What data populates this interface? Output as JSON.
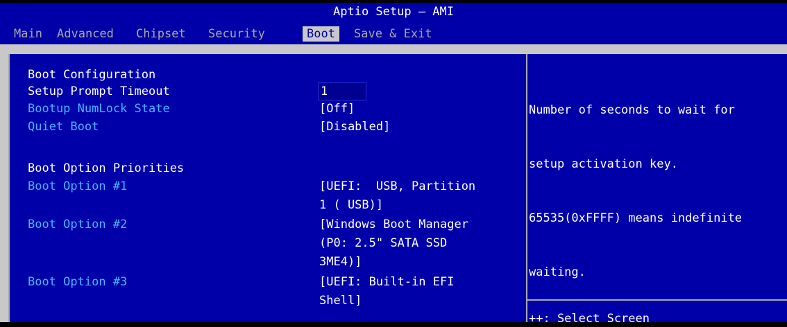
{
  "window": {
    "title": "Aptio Setup – AMI"
  },
  "tabs": [
    {
      "label": "Main"
    },
    {
      "label": "Advanced"
    },
    {
      "label": "Chipset"
    },
    {
      "label": "Security"
    },
    {
      "label": "Boot"
    },
    {
      "label": "Save & Exit"
    }
  ],
  "main": {
    "boot_config_heading": "Boot Configuration",
    "setup_prompt_timeout": {
      "label": "Setup Prompt Timeout",
      "value": "1"
    },
    "bootup_numlock": {
      "label": "Bootup NumLock State",
      "value": "[Off]"
    },
    "quiet_boot": {
      "label": "Quiet Boot",
      "value": "[Disabled]"
    },
    "boot_priorities_heading": "Boot Option Priorities",
    "boot_option_1": {
      "label": "Boot Option #1",
      "value_lines": [
        "[UEFI:  USB, Partition",
        "1 ( USB)]"
      ]
    },
    "boot_option_2": {
      "label": "Boot Option #2",
      "value_lines": [
        "[Windows Boot Manager",
        "(P0: 2.5\" SATA SSD",
        "3ME4)]"
      ]
    },
    "boot_option_3": {
      "label": "Boot Option #3",
      "value_lines": [
        "[UEFI: Built-in EFI",
        "Shell]"
      ]
    }
  },
  "help": {
    "lines": [
      "Number of seconds to wait for",
      "setup activation key.",
      "65535(0xFFFF) means indefinite",
      "waiting."
    ],
    "keys": "++: Select Screen"
  },
  "colors": {
    "panel": "#0000a8",
    "frame": "#c8c8c8",
    "option_label": "#48b4ff",
    "text": "#ffffff"
  }
}
